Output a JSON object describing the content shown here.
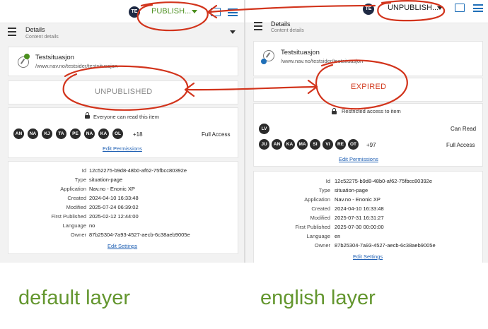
{
  "left": {
    "avatar": "TE",
    "status_button": "PUBLISH...",
    "details_title": "Details",
    "details_subtitle": "Content details",
    "content_name": "Testsituasjon",
    "content_path": "/www.nav.no/testsider/testsituasjon",
    "status": "UNPUBLISHED",
    "permission_note": "Everyone can read this item",
    "principals": [
      "AN",
      "NA",
      "KJ",
      "TA",
      "PE",
      "NA",
      "KA",
      "OL"
    ],
    "principals_more": "+18",
    "access_label": "Full Access",
    "edit_permissions": "Edit Permissions",
    "properties": [
      {
        "key": "Id",
        "value": "12c52275-b9d8-48b0-af62-75fbcc80392e"
      },
      {
        "key": "Type",
        "value": "situation-page"
      },
      {
        "key": "Application",
        "value": "Nav.no - Enonic XP"
      },
      {
        "key": "Created",
        "value": "2024-04-10 16:33:48"
      },
      {
        "key": "Modified",
        "value": "2025-07-24 06:39:02"
      },
      {
        "key": "First Published",
        "value": "2025-02-12 12:44:00"
      },
      {
        "key": "Language",
        "value": "no"
      },
      {
        "key": "Owner",
        "value": "87b25304-7a93-4527-aecb-6c38aeb9005e"
      }
    ],
    "edit_settings": "Edit Settings",
    "layer_label": "default layer"
  },
  "right": {
    "avatar": "TE",
    "status_button": "UNPUBLISH...",
    "details_title": "Details",
    "details_subtitle": "Content details",
    "content_name": "Testsituasjon",
    "content_path": "/www.nav.no/testsider/testsituasjon",
    "status": "EXPIRED",
    "permission_note": "Restricted access to item",
    "principals_read": [
      "LV"
    ],
    "read_label": "Can Read",
    "principals": [
      "JU",
      "AN",
      "KA",
      "MA",
      "SI",
      "VI",
      "RE",
      "OT"
    ],
    "principals_more": "+97",
    "access_label": "Full Access",
    "edit_permissions": "Edit Permissions",
    "properties": [
      {
        "key": "Id",
        "value": "12c52275-b9d8-48b0-af62-75fbcc80392e"
      },
      {
        "key": "Type",
        "value": "situation-page"
      },
      {
        "key": "Application",
        "value": "Nav.no - Enonic XP"
      },
      {
        "key": "Created",
        "value": "2024-04-10 16:33:48"
      },
      {
        "key": "Modified",
        "value": "2025-07-31 16:31:27"
      },
      {
        "key": "First Published",
        "value": "2025-07-30 00:00:00"
      },
      {
        "key": "Language",
        "value": "en"
      },
      {
        "key": "Owner",
        "value": "87b25304-7a93-4527-aecb-6c38aeb9005e"
      }
    ],
    "edit_settings": "Edit Settings",
    "layer_label": "english layer"
  },
  "colors": {
    "publish_green": "#4b8f1e",
    "annotation_red": "#d2341c",
    "expired_red": "#d23a1e",
    "unpublished_gray": "#8a8a8a",
    "link_blue": "#1e5fb3",
    "layer_green": "#63962e"
  }
}
